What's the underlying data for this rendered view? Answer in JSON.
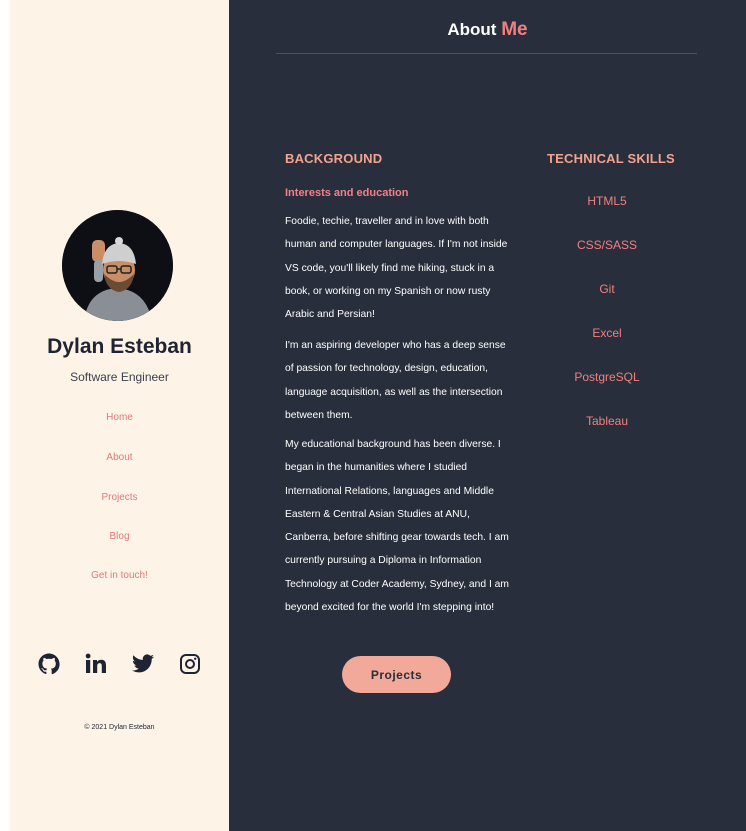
{
  "profile": {
    "name": "Dylan Esteban",
    "role": "Software Engineer"
  },
  "nav": {
    "items": [
      {
        "label": "Home"
      },
      {
        "label": "About"
      },
      {
        "label": "Projects"
      },
      {
        "label": "Blog"
      },
      {
        "label": "Get in touch!"
      }
    ]
  },
  "social": {
    "icons": [
      "github-icon",
      "linkedin-icon",
      "twitter-icon",
      "instagram-icon"
    ]
  },
  "footer": {
    "copyright": "© 2021 Dylan Esteban"
  },
  "page": {
    "title_main": "About",
    "title_accent": "Me"
  },
  "background": {
    "heading": "BACKGROUND",
    "subheading": "Interests and education",
    "paragraphs": [
      "Foodie, techie, traveller and in love with both human and computer languages. If I'm not inside VS code, you'll likely find me hiking, stuck in a book, or working on my Spanish or now rusty Arabic and Persian!",
      "I'm an aspiring developer who has a deep sense of passion for technology, design, education, language acquisition, as well as the intersection between them.",
      "My educational background has been diverse. I began in the humanities where I studied International Relations, languages and Middle Eastern & Central Asian Studies at ANU, Canberra, before shifting gear towards tech. I am currently pursuing a Diploma in Information Technology at Coder Academy, Sydney, and I am beyond excited for the world I'm stepping into!"
    ],
    "button_label": "Projects"
  },
  "skills": {
    "heading": "TECHNICAL SKILLS",
    "items": [
      "HTML5",
      "CSS/SASS",
      "Git",
      "Excel",
      "PostgreSQL",
      "Tableau"
    ]
  },
  "colors": {
    "sidebar_bg": "#fdf4e7",
    "main_bg": "#282e3b",
    "accent": "#f08080",
    "heading_accent": "#f2a38f",
    "button_bg": "#f2a99a"
  }
}
